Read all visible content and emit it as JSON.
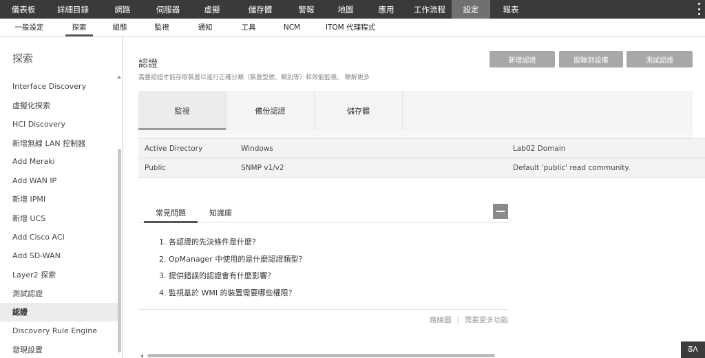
{
  "topnav": {
    "items": [
      "儀表板",
      "詳細目錄",
      "網路",
      "伺服器",
      "虛擬",
      "儲存體",
      "警報",
      "地圖",
      "應用",
      "工作流程",
      "設定",
      "報表"
    ],
    "active": "設定"
  },
  "subnav": {
    "items": [
      "一般設定",
      "探索",
      "組態",
      "監視",
      "通知",
      "工具",
      "NCM",
      "ITOM 代理程式"
    ],
    "active": "探索"
  },
  "sidebar": {
    "title": "探索",
    "items": [
      "Interface Discovery",
      "虛擬化探索",
      "HCI Discovery",
      "新增無線 LAN 控制器",
      "Add Meraki",
      "Add WAN IP",
      "新增 IPMI",
      "新增 UCS",
      "Add Cisco ACI",
      "Add SD-WAN",
      "Layer2 探索",
      "測試認證",
      "認證",
      "Discovery Rule Engine",
      "發現設置"
    ],
    "active": "認證"
  },
  "page": {
    "title": "認證",
    "description": "需要認證才能存取裝置以進行正確分類（裝置型號、類別等）和效能監視。 瞭解更多"
  },
  "buttons": {
    "add": "新增認證",
    "associate": "關聯到設備",
    "test": "測試認證"
  },
  "tabs": [
    "監視",
    "備份認證",
    "儲存體"
  ],
  "credentials": [
    {
      "name": "Active Directory",
      "type": "Windows",
      "description": "Lab02 Domain"
    },
    {
      "name": "Public",
      "type": "SNMP v1/v2",
      "description": "Default 'public' read community."
    }
  ],
  "faq": {
    "tab_faq": "常見問題",
    "tab_kb": "知識庫",
    "questions": [
      "1. 各認證的先決條件是什麼？",
      "2. OpManager 中使用的是什麼認證類型？",
      "3. 提供錯誤的認證會有什麼影響？",
      "4. 監視基於 WMI 的裝置需要哪些權限？"
    ],
    "link_roadmap": "路線圖",
    "separator": "|",
    "link_more": "需要更多功能"
  },
  "corner_badge": "ᘔᐱ"
}
